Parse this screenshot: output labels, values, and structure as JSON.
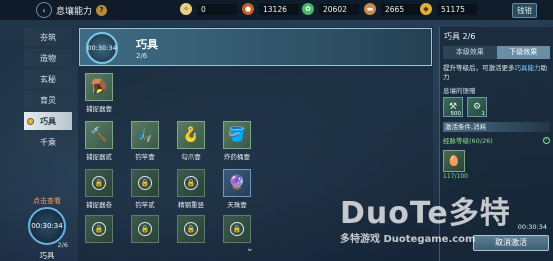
{
  "topbar": {
    "title": "息壤能力",
    "help": "?",
    "resources": [
      {
        "icon": "coin-icon",
        "value": "0",
        "color": "#e8d08a"
      },
      {
        "icon": "copper-icon",
        "value": "13126",
        "color": "#c4622a"
      },
      {
        "icon": "jade-icon",
        "value": "20602",
        "color": "#4ab86a"
      },
      {
        "icon": "scroll-icon",
        "value": "2665",
        "color": "#c98a4a"
      },
      {
        "icon": "gold-icon",
        "value": "51175",
        "color": "#e0b040"
      }
    ],
    "hotkey_label": "钱钳"
  },
  "nav": {
    "items": [
      "夯筑",
      "造物",
      "玄秘",
      "育灵",
      "巧具",
      "千乘"
    ],
    "active_index": 4
  },
  "active_slot": {
    "hint": "点击查看",
    "timer": "00:30:34",
    "progress": "2/6",
    "label": "巧具"
  },
  "banner": {
    "timer": "00:30:34",
    "title": "巧具",
    "subtitle": "2/6"
  },
  "grid": [
    {
      "label": "捕捉器壹",
      "state": "unlocked",
      "glyph": "🪤"
    },
    {
      "label": "捕捉器贰",
      "state": "unlocked",
      "glyph": "🔨"
    },
    {
      "label": "钓竿壹",
      "state": "unlocked",
      "glyph": "🎣"
    },
    {
      "label": "勾爪壹",
      "state": "unlocked",
      "glyph": "🪝"
    },
    {
      "label": "炸药桶壹",
      "state": "unlocked",
      "glyph": "🪣"
    },
    {
      "label": "捕捉器叁",
      "state": "locked",
      "glyph": "🔒"
    },
    {
      "label": "钓竿贰",
      "state": "locked",
      "glyph": "🔒"
    },
    {
      "label": "精钢重竖",
      "state": "locked",
      "glyph": "🔒"
    },
    {
      "label": "天珠壹",
      "state": "blue",
      "glyph": "🔮"
    }
  ],
  "right_panel": {
    "title": "巧具 2/6",
    "tabs": [
      "本级效果",
      "下级效果"
    ],
    "active_tab": 1,
    "desc_prefix": "提升等级后，可激活更多",
    "desc_highlight": "巧具能力",
    "desc_suffix": "助力",
    "cost_header": "息壤的馈赠",
    "gift_items": [
      {
        "glyph": "⚒",
        "count": "500"
      },
      {
        "glyph": "⚙",
        "count": "1"
      }
    ],
    "condition_header": "激活条件,消耗",
    "level_req": "经脉等级(60/26)",
    "cost_count": "117/100",
    "timer": "00:30:34",
    "cancel_label": "取消激活"
  },
  "watermark": {
    "main": "DuoTe多特",
    "sub": "多特游戏 Duotegame.com"
  }
}
